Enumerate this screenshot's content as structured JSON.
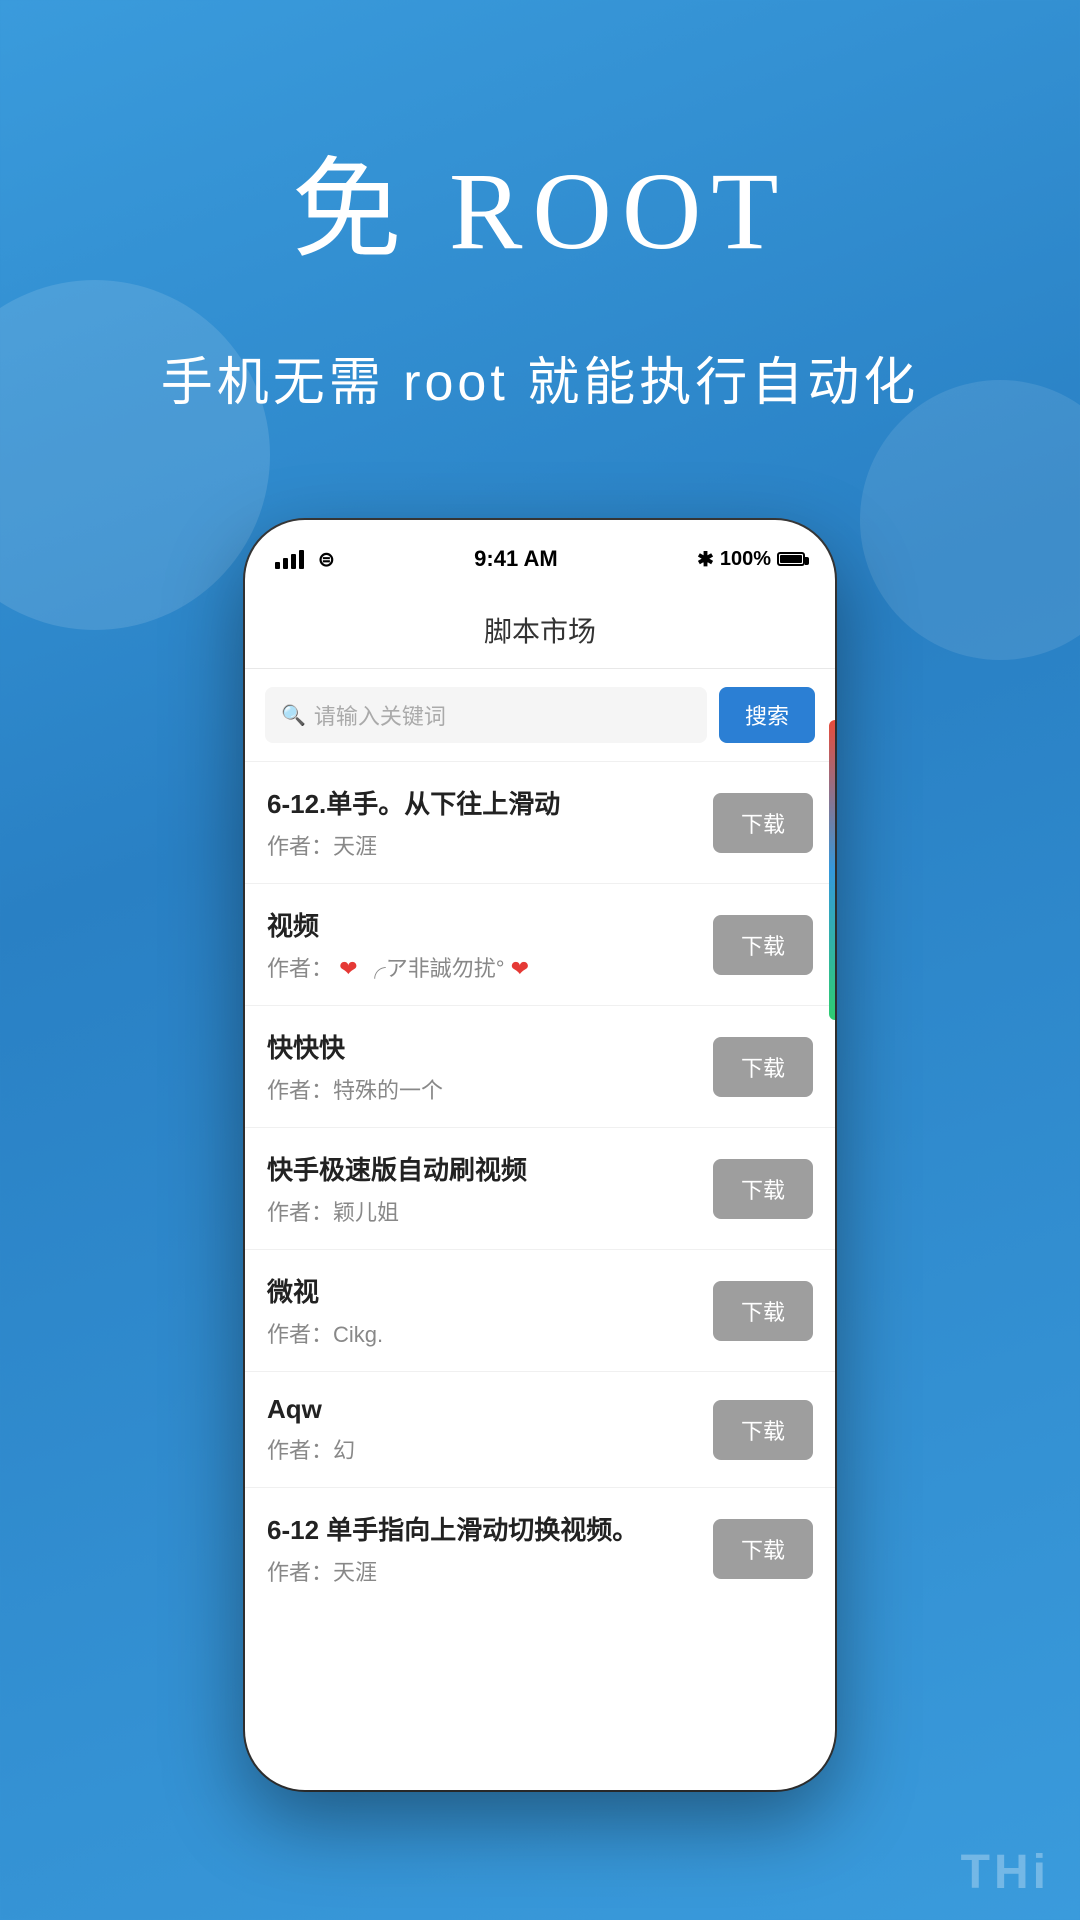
{
  "hero": {
    "title": "免 ROOT",
    "subtitle": "手机无需 root 就能执行自动化"
  },
  "phone": {
    "status_bar": {
      "time": "9:41 AM",
      "bluetooth": "✱",
      "battery": "100%"
    },
    "app_title": "脚本市场",
    "search": {
      "placeholder": "请输入关键词",
      "button_label": "搜索"
    },
    "scripts": [
      {
        "name": "6-12.单手。从下往上滑动",
        "author": "作者：天涯",
        "download_label": "下载"
      },
      {
        "name": "视频",
        "author_prefix": "作者：",
        "author_content": "❤ ╭ア非誠勿扰°❤",
        "download_label": "下载"
      },
      {
        "name": "快快快",
        "author": "作者：特殊的一个",
        "download_label": "下载"
      },
      {
        "name": "快手极速版自动刷视频",
        "author": "作者：颖儿姐",
        "download_label": "下载"
      },
      {
        "name": "微视",
        "author": "作者：Cikg.",
        "download_label": "下载"
      },
      {
        "name": "Aqw",
        "author": "作者：幻",
        "download_label": "下载"
      },
      {
        "name": "6-12 单手指向上滑动切换视频。",
        "author": "作者：天涯",
        "download_label": "下载"
      }
    ]
  },
  "watermark": {
    "text": "THi"
  }
}
